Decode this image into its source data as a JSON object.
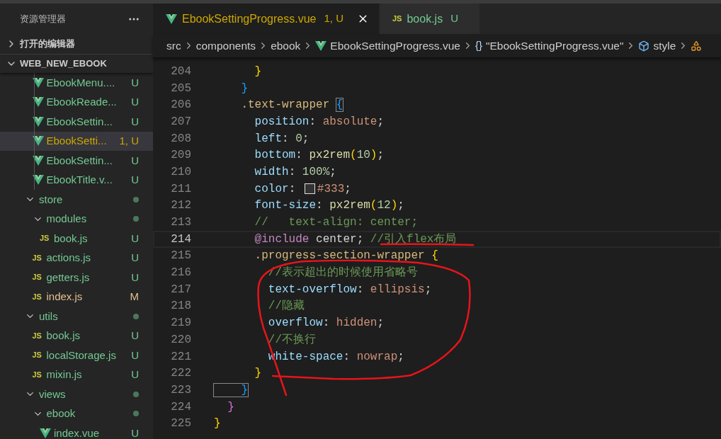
{
  "explorer": {
    "title": "资源管理器",
    "sections": [
      {
        "label": "打开的编辑器",
        "expanded": false
      },
      {
        "label": "WEB_NEW_EBOOK",
        "expanded": true
      }
    ],
    "tree": [
      {
        "kind": "offscreen_folder",
        "children": [
          {
            "label": "EbookMenu....",
            "kind": "vue",
            "status": "U",
            "color": "#73c991",
            "selected": false
          },
          {
            "label": "EbookReade...",
            "kind": "vue",
            "status": "U",
            "color": "#73c991",
            "selected": false
          },
          {
            "label": "EbookSettin...",
            "kind": "vue",
            "status": "U",
            "color": "#73c991",
            "selected": false
          },
          {
            "label": "EbookSetti...",
            "kind": "vue",
            "status": "1, U",
            "color": "#cca700",
            "selected": true
          },
          {
            "label": "EbookSettin...",
            "kind": "vue",
            "status": "U",
            "color": "#73c991",
            "selected": false
          },
          {
            "label": "EbookTitle.v...",
            "kind": "vue",
            "status": "U",
            "color": "#73c991",
            "selected": false
          }
        ]
      },
      {
        "label": "store",
        "kind": "folder",
        "expanded": true,
        "color": "#73c991",
        "selected": false,
        "children": [
          {
            "label": "modules",
            "kind": "folder",
            "expanded": true,
            "color": "#73c991",
            "selected": false,
            "children": [
              {
                "label": "book.js",
                "kind": "js",
                "icon": "JS",
                "status": "U",
                "color": "#73c991",
                "selected": false
              }
            ]
          },
          {
            "label": "actions.js",
            "kind": "js",
            "icon": "JS",
            "status": "U",
            "color": "#73c991",
            "selected": false
          },
          {
            "label": "getters.js",
            "kind": "js",
            "icon": "JS",
            "status": "U",
            "color": "#73c991",
            "selected": false
          },
          {
            "label": "index.js",
            "kind": "js",
            "icon": "JS",
            "status": "M",
            "color": "#e2c08d",
            "selected": false
          }
        ]
      },
      {
        "label": "utils",
        "kind": "folder",
        "expanded": true,
        "color": "#73c991",
        "selected": false,
        "children": [
          {
            "label": "book.js",
            "kind": "js",
            "icon": "JS",
            "status": "U",
            "color": "#73c991",
            "selected": false
          },
          {
            "label": "localStorage.js",
            "kind": "js",
            "icon": "JS",
            "status": "U",
            "color": "#73c991",
            "selected": false
          },
          {
            "label": "mixin.js",
            "kind": "js",
            "icon": "JS",
            "status": "U",
            "color": "#73c991",
            "selected": false
          }
        ]
      },
      {
        "label": "views",
        "kind": "folder",
        "expanded": true,
        "color": "#73c991",
        "selected": false,
        "children": [
          {
            "label": "ebook",
            "kind": "folder",
            "expanded": true,
            "color": "#73c991",
            "selected": false,
            "children": [
              {
                "label": "index.vue",
                "kind": "vue",
                "status": "U",
                "color": "#73c991",
                "selected": false
              }
            ]
          }
        ]
      }
    ]
  },
  "tabs": [
    {
      "label": "EbookSettingProgress.vue",
      "status": "1, U",
      "kind": "vue",
      "color": "#cca700",
      "selected": true
    },
    {
      "label": "book.js",
      "status": "U",
      "kind": "js",
      "icon": "JS",
      "color": "#73c991",
      "selected": false
    }
  ],
  "breadcrumb": [
    {
      "label": "src",
      "kind": "plain"
    },
    {
      "label": "components",
      "kind": "plain"
    },
    {
      "label": "ebook",
      "kind": "plain"
    },
    {
      "label": "EbookSettingProgress.vue",
      "kind": "vue"
    },
    {
      "label": "\"EbookSettingProgress.vue\"",
      "kind": "object",
      "icon": "{}"
    },
    {
      "label": "style",
      "kind": "element"
    },
    {
      "kind": "property"
    }
  ],
  "editor": {
    "lines": [
      {
        "number": "204",
        "current": false,
        "tokens": [
          {
            "text": "      }",
            "kind": "brace_yellow"
          }
        ]
      },
      {
        "number": "205",
        "current": false,
        "tokens": [
          {
            "text": "    }",
            "kind": "brace_blue"
          }
        ]
      },
      {
        "number": "206",
        "current": false,
        "tokens": [
          {
            "text": "    .text-wrapper ",
            "kind": "selector"
          },
          {
            "text": "{",
            "kind": "brace_blue_matched"
          }
        ]
      },
      {
        "number": "207",
        "current": false,
        "tokens": [
          {
            "text": "      position",
            "kind": "prop"
          },
          {
            "text": ": ",
            "kind": "punct"
          },
          {
            "text": "absolute",
            "kind": "value"
          },
          {
            "text": ";",
            "kind": "punct"
          }
        ]
      },
      {
        "number": "208",
        "current": false,
        "tokens": [
          {
            "text": "      left",
            "kind": "prop"
          },
          {
            "text": ": ",
            "kind": "punct"
          },
          {
            "text": "0",
            "kind": "number"
          },
          {
            "text": ";",
            "kind": "punct"
          }
        ]
      },
      {
        "number": "209",
        "current": false,
        "tokens": [
          {
            "text": "      bottom",
            "kind": "prop"
          },
          {
            "text": ": ",
            "kind": "punct"
          },
          {
            "text": "px2rem",
            "kind": "func"
          },
          {
            "text": "(",
            "kind": "brace_yellow"
          },
          {
            "text": "10",
            "kind": "number"
          },
          {
            "text": ")",
            "kind": "brace_yellow"
          },
          {
            "text": ";",
            "kind": "punct"
          }
        ]
      },
      {
        "number": "210",
        "current": false,
        "tokens": [
          {
            "text": "      width",
            "kind": "prop"
          },
          {
            "text": ": ",
            "kind": "punct"
          },
          {
            "text": "100%",
            "kind": "number"
          },
          {
            "text": ";",
            "kind": "punct"
          }
        ]
      },
      {
        "number": "211",
        "current": false,
        "tokens": [
          {
            "text": "      color",
            "kind": "prop"
          },
          {
            "text": ": ",
            "kind": "punct"
          },
          {
            "kind": "swatch",
            "color": "#333333"
          },
          {
            "text": "#333",
            "kind": "value"
          },
          {
            "text": ";",
            "kind": "punct"
          }
        ]
      },
      {
        "number": "212",
        "current": false,
        "tokens": [
          {
            "text": "      font-size",
            "kind": "prop"
          },
          {
            "text": ": ",
            "kind": "punct"
          },
          {
            "text": "px2rem",
            "kind": "func"
          },
          {
            "text": "(",
            "kind": "brace_yellow"
          },
          {
            "text": "12",
            "kind": "number"
          },
          {
            "text": ")",
            "kind": "brace_yellow"
          },
          {
            "text": ";",
            "kind": "punct"
          }
        ]
      },
      {
        "number": "213",
        "current": false,
        "tokens": [
          {
            "text": "      //   text-align: center;",
            "kind": "comment"
          }
        ]
      },
      {
        "number": "214",
        "current": true,
        "tokens": [
          {
            "text": "      @include",
            "kind": "at"
          },
          {
            "text": " center; ",
            "kind": "punct"
          },
          {
            "text": "//引入flex布局",
            "kind": "comment"
          }
        ]
      },
      {
        "number": "215",
        "current": false,
        "tokens": [
          {
            "text": "      .progress-section-wrapper ",
            "kind": "selector"
          },
          {
            "text": "{",
            "kind": "brace_yellow"
          }
        ]
      },
      {
        "number": "216",
        "current": false,
        "tokens": [
          {
            "text": "        //表示超出的时候使用省略号",
            "kind": "comment"
          }
        ]
      },
      {
        "number": "217",
        "current": false,
        "tokens": [
          {
            "text": "        text-overflow",
            "kind": "prop"
          },
          {
            "text": ": ",
            "kind": "punct"
          },
          {
            "text": "ellipsis",
            "kind": "value"
          },
          {
            "text": ";",
            "kind": "punct"
          }
        ]
      },
      {
        "number": "218",
        "current": false,
        "tokens": [
          {
            "text": "        //隐藏",
            "kind": "comment"
          }
        ]
      },
      {
        "number": "219",
        "current": false,
        "tokens": [
          {
            "text": "        overflow",
            "kind": "prop"
          },
          {
            "text": ": ",
            "kind": "punct"
          },
          {
            "text": "hidden",
            "kind": "value"
          },
          {
            "text": ";",
            "kind": "punct"
          }
        ]
      },
      {
        "number": "220",
        "current": false,
        "tokens": [
          {
            "text": "        //不换行",
            "kind": "comment"
          }
        ]
      },
      {
        "number": "221",
        "current": false,
        "tokens": [
          {
            "text": "        white-space",
            "kind": "prop"
          },
          {
            "text": ": ",
            "kind": "punct"
          },
          {
            "text": "nowrap",
            "kind": "value"
          },
          {
            "text": ";",
            "kind": "punct"
          }
        ]
      },
      {
        "number": "222",
        "current": false,
        "tokens": [
          {
            "text": "      }",
            "kind": "brace_yellow"
          }
        ]
      },
      {
        "number": "223",
        "current": false,
        "tokens": [
          {
            "text": "    }",
            "kind": "brace_blue_matched"
          }
        ]
      },
      {
        "number": "224",
        "current": false,
        "tokens": [
          {
            "text": "  }",
            "kind": "brace_magenta"
          }
        ]
      },
      {
        "number": "225",
        "current": false,
        "tokens": [
          {
            "text": "}",
            "kind": "brace_yellow"
          }
        ]
      }
    ]
  }
}
